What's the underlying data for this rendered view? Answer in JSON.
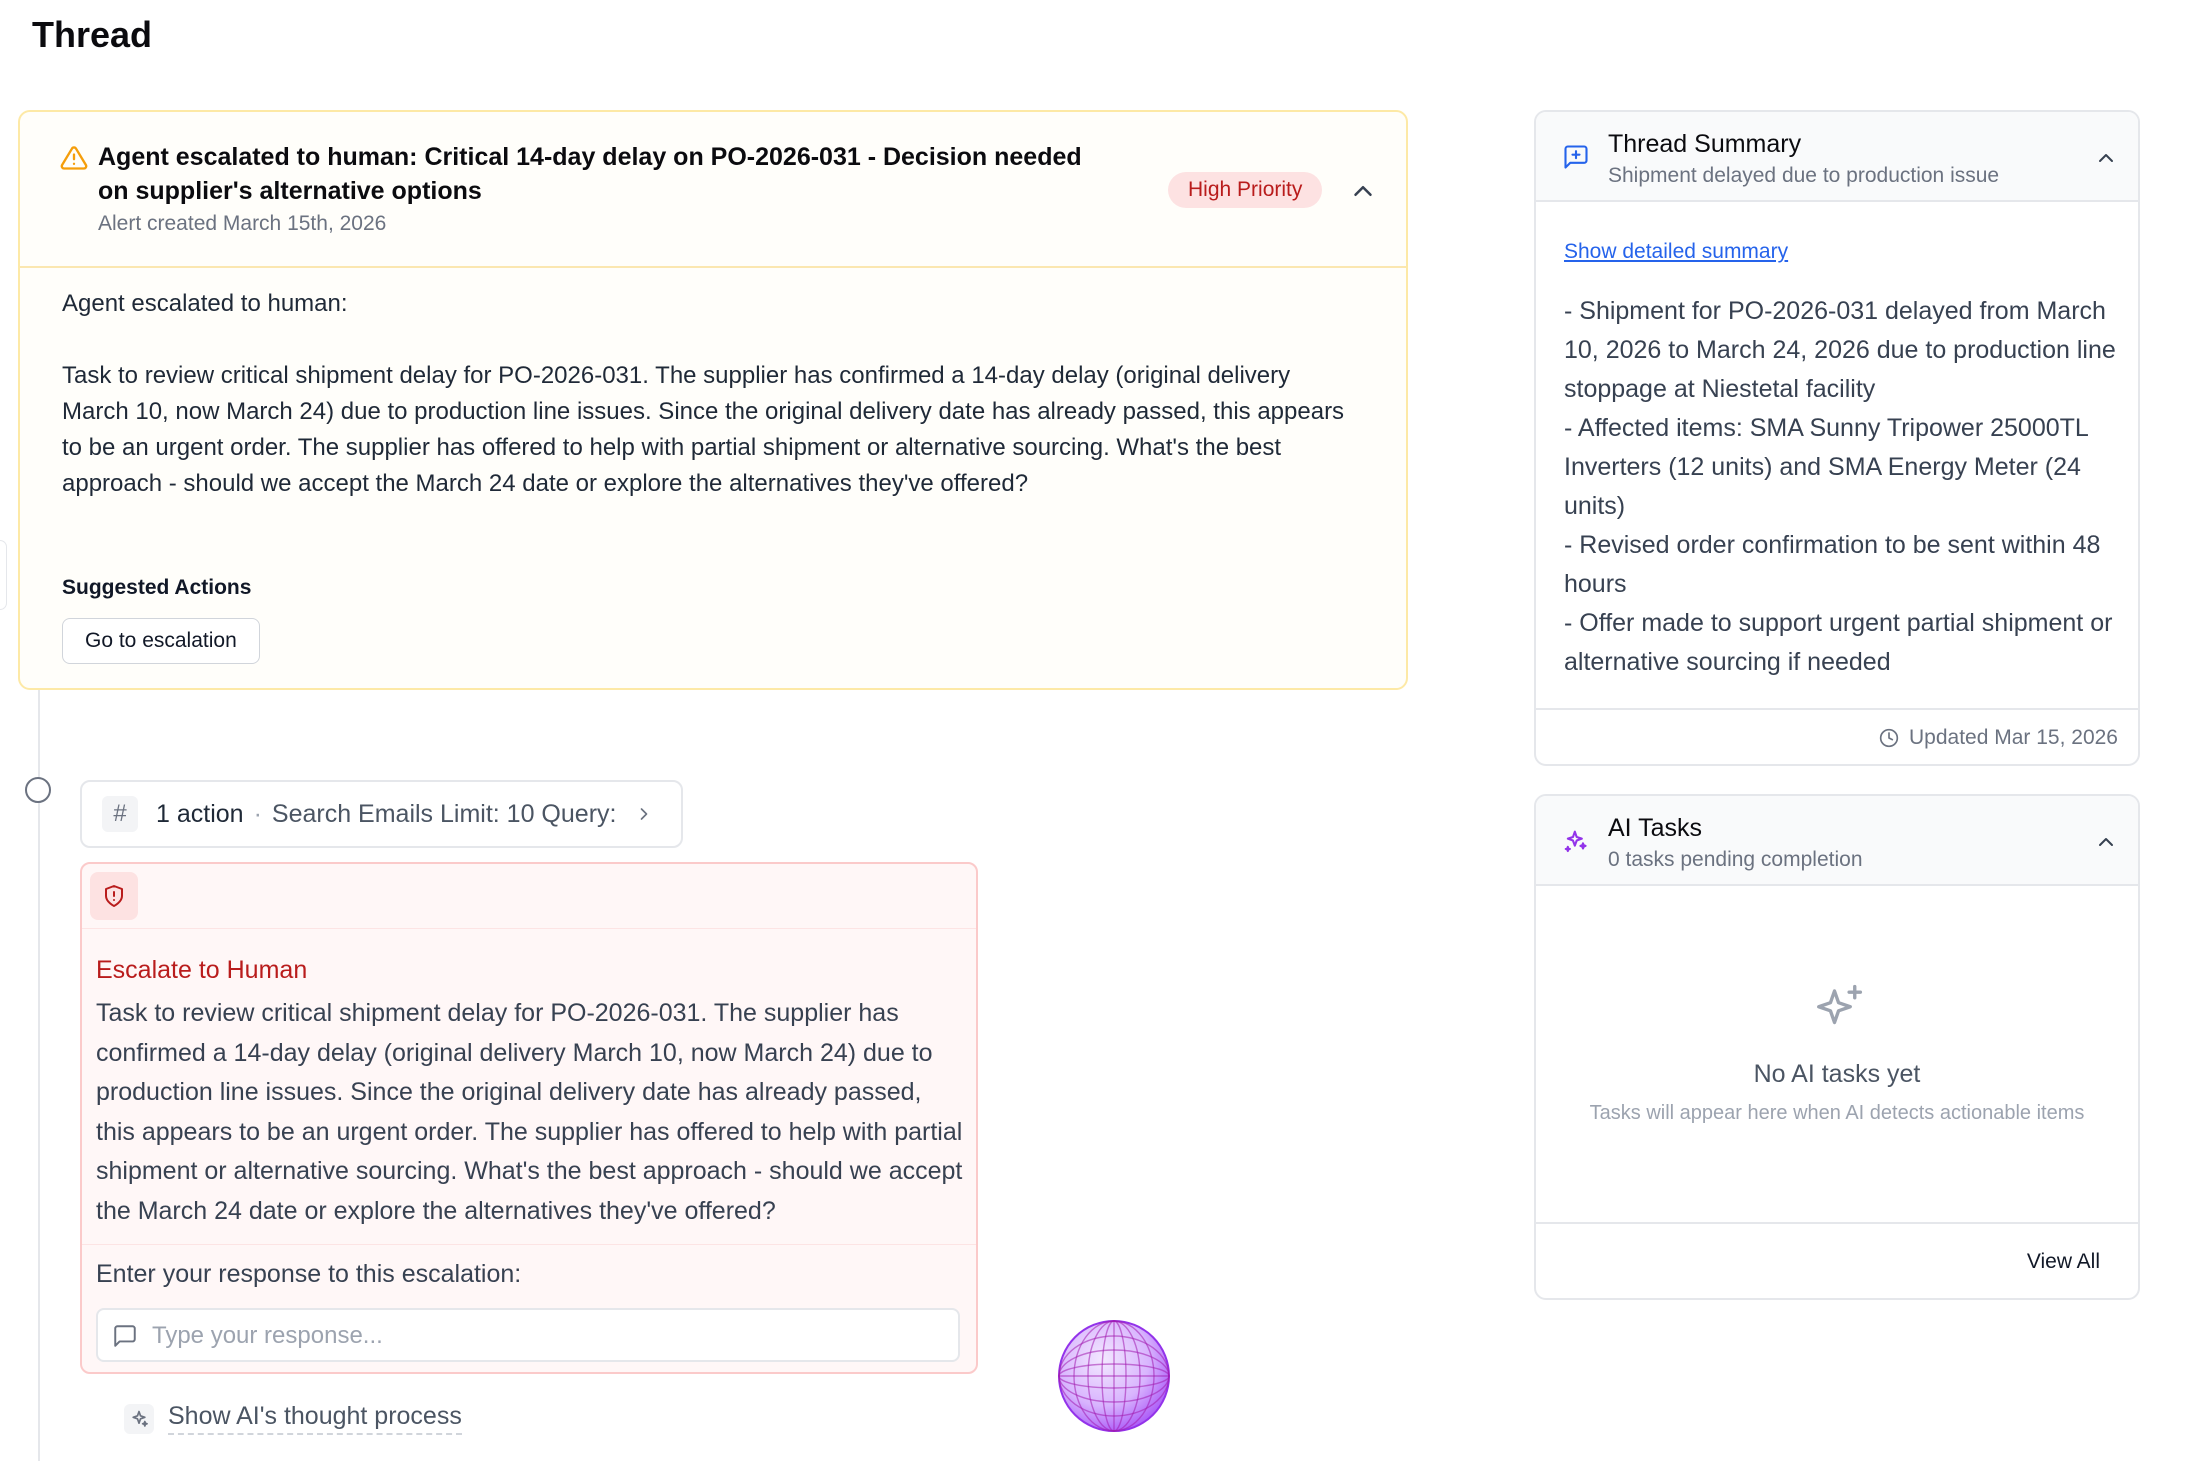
{
  "page": {
    "title": "Thread"
  },
  "alert": {
    "title": "Agent escalated to human: Critical 14-day delay on PO-2026-031 - Decision needed on supplier's alternative options",
    "created": "Alert created March 15th, 2026",
    "priority": "High Priority",
    "intro": "Agent escalated to human:",
    "body": "Task to review critical shipment delay for PO-2026-031. The supplier has confirmed a 14-day delay (original delivery March 10, now March 24) due to production line issues. Since the original delivery date has already passed, this appears to be an urgent order. The supplier has offered to help with partial shipment or alternative sourcing. What's the best approach - should we accept the March 24 date or explore the alternatives they've offered?",
    "suggested_label": "Suggested Actions",
    "suggested_action": "Go to escalation",
    "colors": {
      "border": "#fde9a6",
      "warning": "#f59e0b",
      "badge_bg": "#fde2e2",
      "badge_text": "#b91c1c"
    }
  },
  "action": {
    "icon": "#",
    "count": "1 action",
    "separator": "·",
    "description": "Search Emails Limit: 10 Query:"
  },
  "escalation": {
    "title": "Escalate to Human",
    "body": "Task to review critical shipment delay for PO-2026-031. The supplier has confirmed a 14-day delay (original delivery March 10, now March 24) due to production line issues. Since the original delivery date has already passed, this appears to be an urgent order. The supplier has offered to help with partial shipment or alternative sourcing. What's the best approach - should we accept the March 24 date or explore the alternatives they've offered?",
    "prompt": "Enter your response to this escalation:",
    "placeholder": "Type your response...",
    "value": ""
  },
  "thought": {
    "label": "Show AI's thought process"
  },
  "summary": {
    "title": "Thread Summary",
    "subtitle": "Shipment delayed due to production issue",
    "link": "Show detailed summary",
    "lines": [
      "- Shipment for PO-2026-031 delayed from March 10, 2026 to March 24, 2026 due to production line stoppage at Niestetal facility",
      "- Affected items: SMA Sunny Tripower 25000TL Inverters (12 units) and SMA Energy Meter (24 units)",
      "- Revised order confirmation to be sent within 48 hours",
      "- Offer made to support urgent partial shipment or alternative sourcing if needed"
    ],
    "updated": "Updated Mar 15, 2026"
  },
  "tasks": {
    "title": "AI Tasks",
    "subtitle": "0 tasks pending completion",
    "empty_title": "No AI tasks yet",
    "empty_sub": "Tasks will appear here when AI detects actionable items",
    "view_all": "View All"
  },
  "icons": {
    "alert": "warning-triangle-icon",
    "escalation": "shield-alert-icon",
    "summary": "message-square-icon",
    "tasks": "sparkles-icon",
    "thought": "sparkles-icon",
    "input": "message-square-icon",
    "updated": "clock-icon"
  }
}
